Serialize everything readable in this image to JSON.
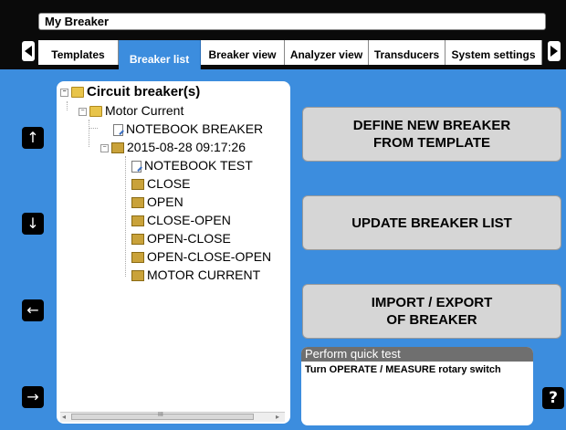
{
  "window": {
    "title": "My Breaker"
  },
  "tabs": [
    {
      "label": "Templates",
      "active": false
    },
    {
      "label": "Breaker list",
      "active": true
    },
    {
      "label": "Breaker view",
      "active": false
    },
    {
      "label": "Analyzer view",
      "active": false
    },
    {
      "label": "Transducers",
      "active": false
    },
    {
      "label": "System settings",
      "active": false
    }
  ],
  "nav": {
    "up": "↑",
    "down": "↓",
    "left": "←",
    "right": "→",
    "help": "?"
  },
  "tree": {
    "root": "Circuit breaker(s)",
    "group": "Motor Current",
    "breaker": "NOTEBOOK BREAKER",
    "session": "2015-08-28 09:17:26",
    "items": [
      "NOTEBOOK TEST",
      "CLOSE",
      "OPEN",
      "CLOSE-OPEN",
      "OPEN-CLOSE",
      "OPEN-CLOSE-OPEN",
      "MOTOR CURRENT"
    ],
    "scroll_thumb_label": "III"
  },
  "actions": {
    "define_line1": "DEFINE NEW BREAKER",
    "define_line2": "FROM TEMPLATE",
    "update": "UPDATE BREAKER LIST",
    "import_line1": "IMPORT / EXPORT",
    "import_line2": "OF BREAKER"
  },
  "quick_test": {
    "header": "Perform quick test",
    "message": "Turn OPERATE / MEASURE rotary switch"
  },
  "colors": {
    "background": "#3c8dde",
    "button": "#d6d6d6",
    "bar": "#0a0a0a"
  }
}
